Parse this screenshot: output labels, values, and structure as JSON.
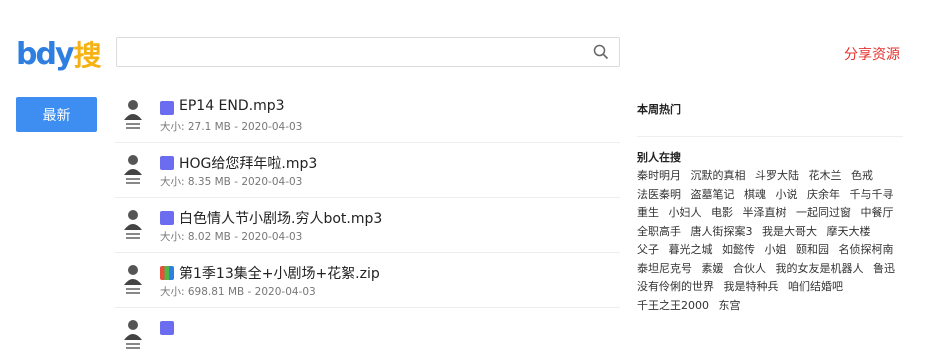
{
  "header": {
    "logo_latin": "bdy",
    "logo_cjk": "搜",
    "search_value": "",
    "search_placeholder": "",
    "share_link": "分享资源"
  },
  "sidebar": {
    "latest_button": "最新"
  },
  "files": [
    {
      "icon": "audio-file-icon",
      "name": "EP14 END.mp3",
      "meta": "大小: 27.1 MB - 2020-04-03"
    },
    {
      "icon": "audio-file-icon",
      "name": "HOG给您拜年啦.mp3",
      "meta": "大小: 8.35 MB - 2020-04-03"
    },
    {
      "icon": "audio-file-icon",
      "name": "白色情人节小剧场.穷人bot.mp3",
      "meta": "大小: 8.02 MB - 2020-04-03"
    },
    {
      "icon": "zip-file-icon",
      "name": "第1季13集全+小剧场+花絮.zip",
      "meta": "大小: 698.81 MB - 2020-04-03"
    },
    {
      "icon": "audio-file-icon",
      "name": "",
      "meta": ""
    }
  ],
  "right_panel": {
    "hot_title": "本周热门",
    "others_title": "别人在搜",
    "tags": [
      "秦时明月",
      "沉默的真相",
      "斗罗大陆",
      "花木兰",
      "色戒",
      "法医秦明",
      "盗墓笔记",
      "棋魂",
      "小说",
      "庆余年",
      "千与千寻",
      "重生",
      "小妇人",
      "电影",
      "半泽直树",
      "一起同过窗",
      "中餐厅",
      "全职高手",
      "唐人街探案3",
      "我是大哥大",
      "摩天大楼",
      "父子",
      "暮光之城",
      "如懿传",
      "小姐",
      "颐和园",
      "名侦探柯南",
      "泰坦尼克号",
      "素媛",
      "合伙人",
      "我的女友是机器人",
      "鲁迅",
      "没有伶俐的世界",
      "我是特种兵",
      "咱们结婚吧",
      "千王之王2000",
      "东宫"
    ]
  },
  "colors": {
    "accent": "#3d8ef0",
    "share": "#e5312f",
    "logo_blue": "#2f7fe0",
    "logo_yellow": "#f6b214"
  }
}
